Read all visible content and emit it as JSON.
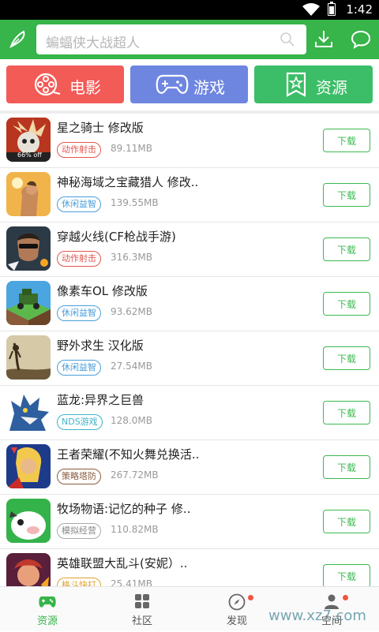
{
  "status_bar": {
    "time": "1:42"
  },
  "header": {
    "search_placeholder": "蝙蝠侠大战超人",
    "icons": [
      "feather-icon",
      "search-icon",
      "download-icon",
      "message-icon"
    ]
  },
  "categories": [
    {
      "label": "电影",
      "icon": "film-reel-icon",
      "color": "#f35b57"
    },
    {
      "label": "游戏",
      "icon": "gamepad-icon",
      "color": "#6e86e0"
    },
    {
      "label": "资源",
      "icon": "star-bookmark-icon",
      "color": "#3cbd67"
    }
  ],
  "apps": [
    {
      "name": "星之骑士  修改版",
      "tag": "动作射击",
      "tag_color": "#e2564f",
      "size": "89.11MB",
      "button": "下载",
      "icon_badge": "66% off"
    },
    {
      "name": "神秘海域之宝藏猎人  修改..",
      "tag": "休闲益智",
      "tag_color": "#4a9ed8",
      "size": "139.55MB",
      "button": "下载"
    },
    {
      "name": "穿越火线(CF枪战手游)",
      "tag": "动作射击",
      "tag_color": "#e2564f",
      "size": "316.3MB",
      "button": "下载"
    },
    {
      "name": "像素车OL  修改版",
      "tag": "休闲益智",
      "tag_color": "#4a9ed8",
      "size": "93.62MB",
      "button": "下载"
    },
    {
      "name": "野外求生  汉化版",
      "tag": "休闲益智",
      "tag_color": "#4a9ed8",
      "size": "27.54MB",
      "button": "下载"
    },
    {
      "name": "蓝龙:异界之巨兽",
      "tag": "NDS游戏",
      "tag_color": "#3fb2c9",
      "size": "128.0MB",
      "button": "下载"
    },
    {
      "name": "王者荣耀(不知火舞兑换活..",
      "tag": "策略塔防",
      "tag_color": "#8a5a3c",
      "size": "267.72MB",
      "button": "下载"
    },
    {
      "name": "牧场物语:记忆的种子  修..",
      "tag": "模拟经营",
      "tag_color": "#888888",
      "size": "110.82MB",
      "button": "下载"
    },
    {
      "name": "英雄联盟大乱斗(安妮）..",
      "tag": "格斗快打",
      "tag_color": "#e0a030",
      "size": "25.41MB",
      "button": "下载"
    }
  ],
  "tabs": [
    {
      "label": "资源",
      "icon": "gamepad-icon",
      "active": true
    },
    {
      "label": "社区",
      "icon": "grid-icon",
      "active": false
    },
    {
      "label": "发现",
      "icon": "compass-icon",
      "active": false,
      "dot": true
    },
    {
      "label": "空间",
      "icon": "person-icon",
      "active": false,
      "dot": true
    }
  ],
  "watermark": "www.xz7.com",
  "colors": {
    "primary": "#37b44a",
    "button_green": "#3cba52"
  }
}
